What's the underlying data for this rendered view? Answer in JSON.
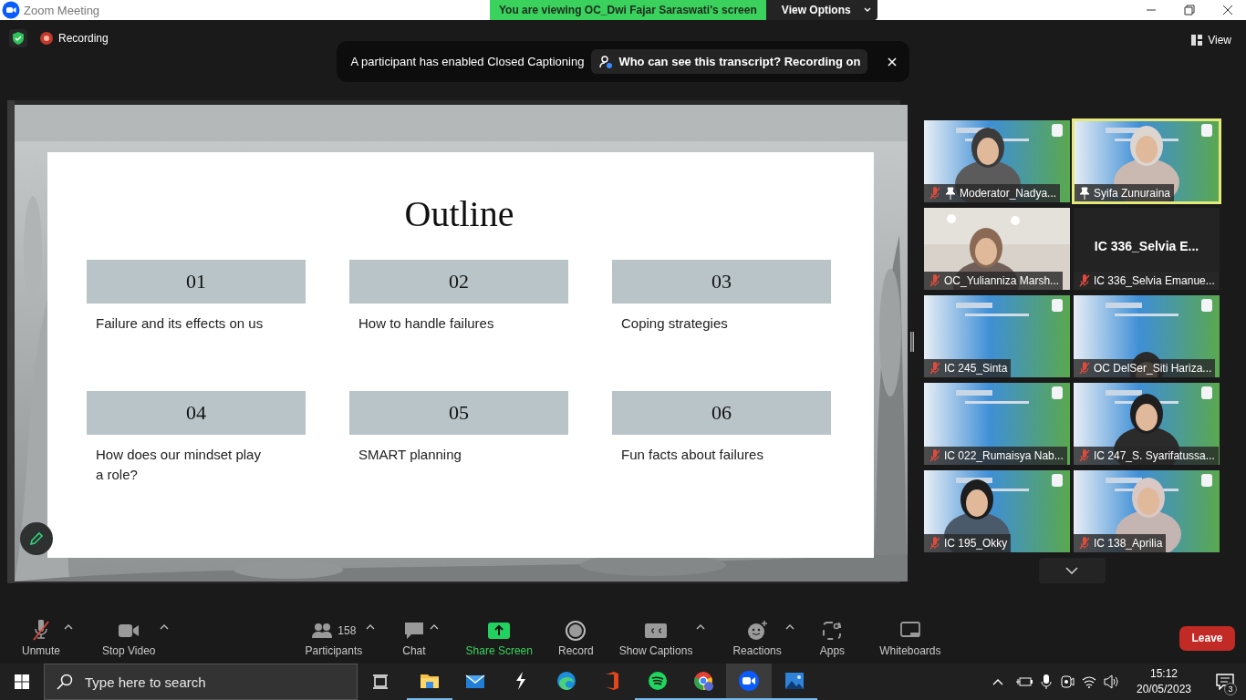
{
  "window": {
    "title": "Zoom Meeting"
  },
  "share_banner": {
    "text": "You are viewing OC_Dwi Fajar Saraswati's screen",
    "button": "View Options"
  },
  "top_bar": {
    "recording": "Recording",
    "view_button": "View"
  },
  "notification": {
    "message": "A participant has enabled Closed Captioning",
    "action": "Who can see this transcript? Recording on"
  },
  "slide": {
    "title": "Outline",
    "items": [
      {
        "number": "01",
        "text": "Failure and its effects on us"
      },
      {
        "number": "02",
        "text": "How to handle failures"
      },
      {
        "number": "03",
        "text": "Coping strategies"
      },
      {
        "number": "04",
        "text": "How does our mindset play a role?"
      },
      {
        "number": "05",
        "text": "SMART planning"
      },
      {
        "number": "06",
        "text": "Fun facts about failures"
      }
    ]
  },
  "gallery": {
    "participants": [
      {
        "kind": "video",
        "name": "Moderator_Nadya...",
        "muted": true,
        "pinned": true,
        "speaking": false
      },
      {
        "kind": "video",
        "name": "Syifa Zunuraina",
        "muted": false,
        "pinned": true,
        "speaking": true
      },
      {
        "kind": "video",
        "name": "OC_Yulianniza Marsh...",
        "muted": true,
        "pinned": false,
        "speaking": false
      },
      {
        "kind": "no_video",
        "display_name": "IC 336_Selvia E...",
        "name": "IC 336_Selvia Emanue...",
        "muted": true,
        "pinned": false,
        "speaking": false
      },
      {
        "kind": "video",
        "name": "IC 245_Sinta",
        "muted": true,
        "pinned": false,
        "speaking": false
      },
      {
        "kind": "video",
        "name": "OC DelSer_Siti Hariza...",
        "muted": true,
        "pinned": false,
        "speaking": false
      },
      {
        "kind": "video",
        "name": "IC 022_Rumaisya Nab...",
        "muted": true,
        "pinned": false,
        "speaking": false
      },
      {
        "kind": "video",
        "name": "IC 247_S. Syarifatussa...",
        "muted": true,
        "pinned": false,
        "speaking": false
      },
      {
        "kind": "video",
        "name": "IC 195_Okky",
        "muted": true,
        "pinned": false,
        "speaking": false
      },
      {
        "kind": "video",
        "name": "IC 138_Aprilia",
        "muted": true,
        "pinned": false,
        "speaking": false
      }
    ]
  },
  "toolbar": {
    "items": [
      {
        "kind": "mic",
        "label": "Unmute",
        "caret": true,
        "muted": true
      },
      {
        "kind": "video",
        "label": "Stop Video",
        "caret": true
      },
      {
        "kind": "participants",
        "label": "Participants",
        "count": "158",
        "caret": true
      },
      {
        "kind": "chat",
        "label": "Chat",
        "caret": true
      },
      {
        "kind": "share",
        "label": "Share Screen",
        "caret": false
      },
      {
        "kind": "record",
        "label": "Record",
        "caret": false
      },
      {
        "kind": "captions",
        "label": "Show Captions",
        "caret": true
      },
      {
        "kind": "reactions",
        "label": "Reactions",
        "caret": true
      },
      {
        "kind": "apps",
        "label": "Apps",
        "caret": false
      },
      {
        "kind": "whiteboards",
        "label": "Whiteboards",
        "caret": false
      }
    ],
    "leave": "Leave"
  },
  "taskbar": {
    "search_placeholder": "Type here to search",
    "apps": [
      {
        "kind": "explorer",
        "running": true,
        "active": false
      },
      {
        "kind": "mail",
        "running": false,
        "active": false
      },
      {
        "kind": "bolt",
        "running": false,
        "active": false
      },
      {
        "kind": "edge",
        "running": false,
        "active": false
      },
      {
        "kind": "office",
        "running": false,
        "active": false
      },
      {
        "kind": "spotify",
        "running": true,
        "active": false
      },
      {
        "kind": "chrome",
        "running": true,
        "active": false
      },
      {
        "kind": "zoom",
        "running": true,
        "active": true
      },
      {
        "kind": "photos",
        "running": true,
        "active": false
      }
    ],
    "time": "15:12",
    "date": "20/05/2023",
    "notifications": "3"
  }
}
